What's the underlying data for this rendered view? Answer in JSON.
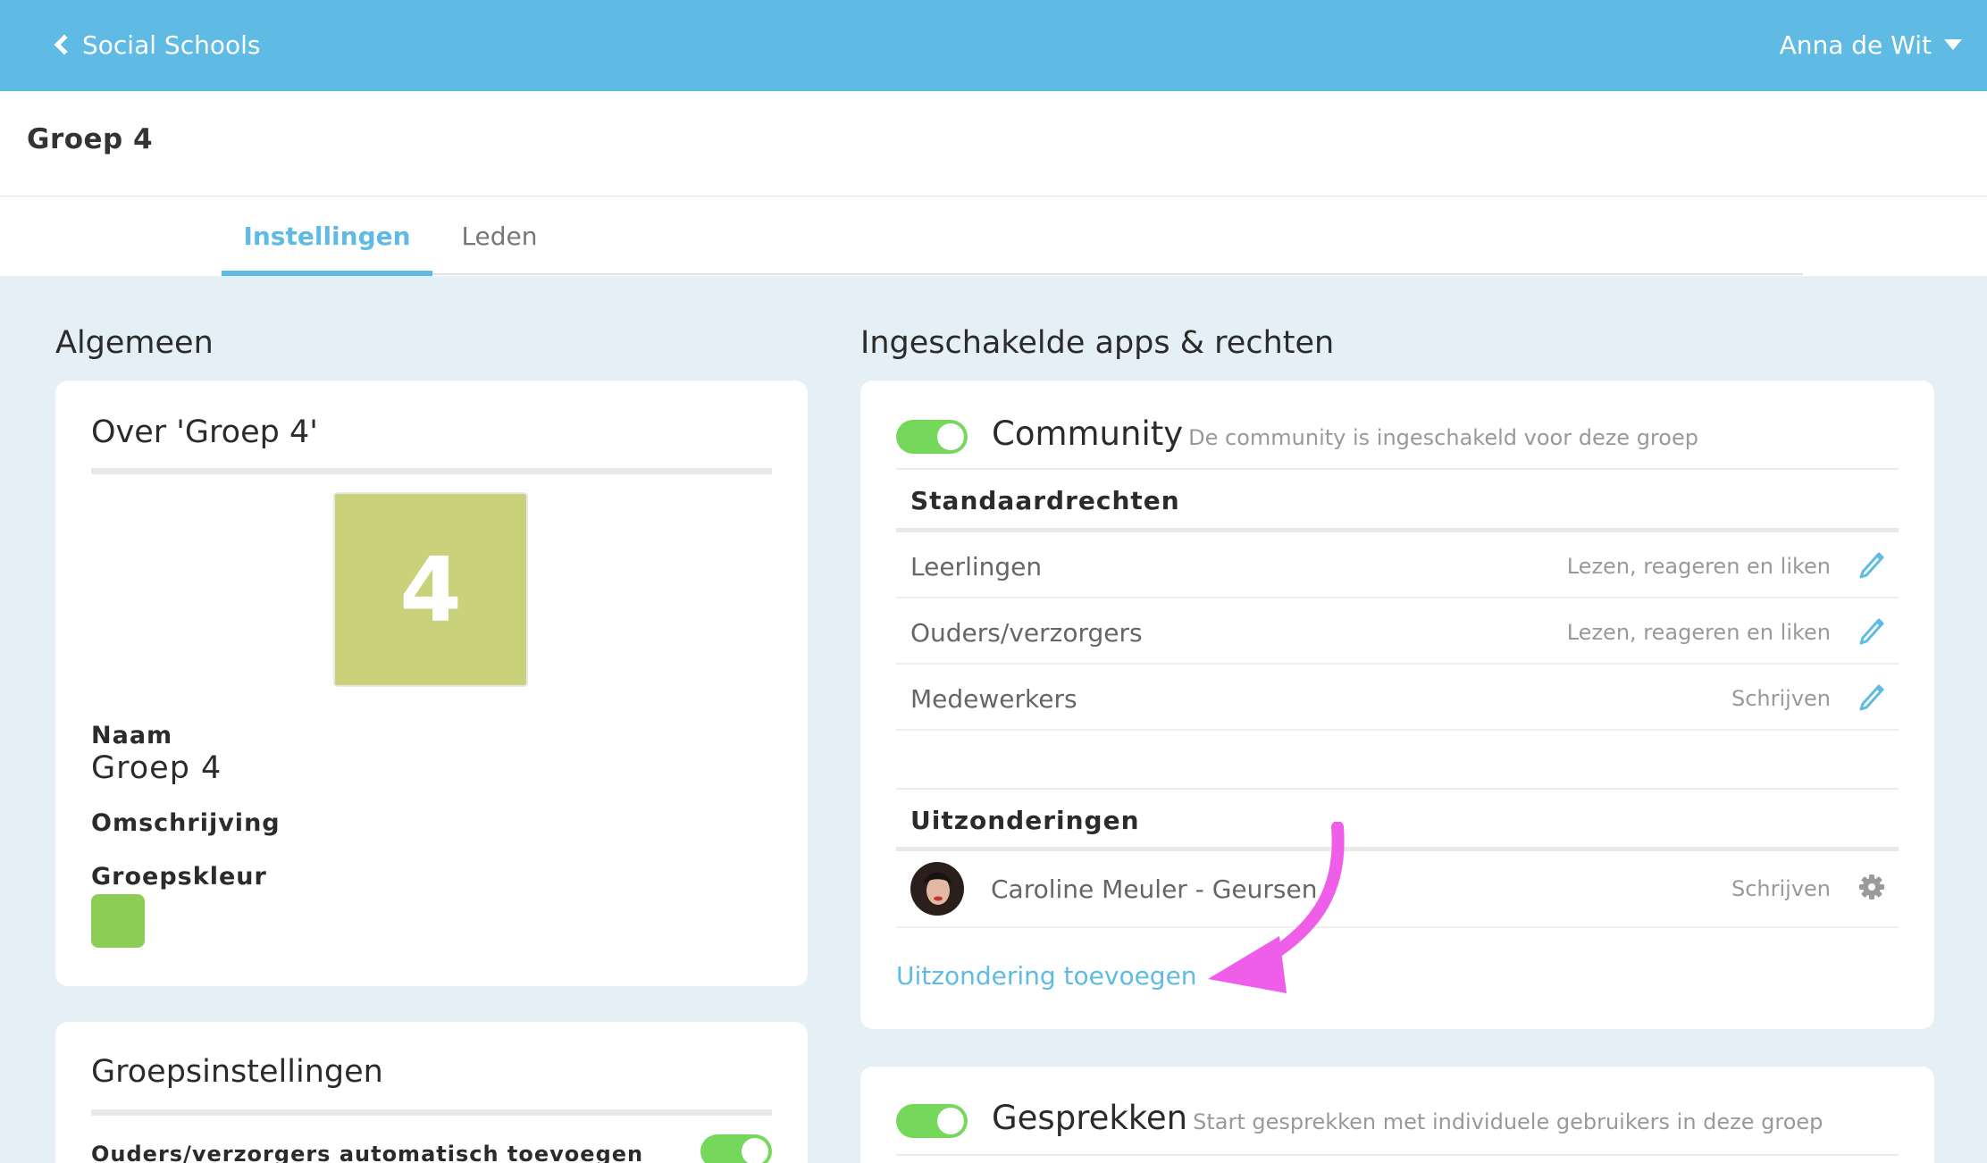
{
  "topbar": {
    "back_label": "Social Schools",
    "user_name": "Anna de Wit"
  },
  "page": {
    "title": "Groep 4"
  },
  "tabs": [
    {
      "label": "Instellingen",
      "active": true
    },
    {
      "label": "Leden",
      "active": false
    }
  ],
  "general": {
    "heading": "Algemeen",
    "about": {
      "title": "Over 'Groep 4'",
      "avatar_text": "4",
      "avatar_color": "#c9d17a",
      "name_label": "Naam",
      "name_value": "Groep 4",
      "description_label": "Omschrijving",
      "color_label": "Groepskleur",
      "group_color": "#8bcd55"
    },
    "settings": {
      "title": "Groepsinstellingen",
      "auto_add_label": "Ouders/verzorgers automatisch toevoegen",
      "auto_add_enabled": true
    }
  },
  "apps": {
    "heading": "Ingeschakelde apps & rechten",
    "community": {
      "enabled": true,
      "title": "Community",
      "description": "De community is ingeschakeld voor deze groep",
      "standard_rights_heading": "Standaardrechten",
      "rights": [
        {
          "role": "Leerlingen",
          "permission": "Lezen, reageren en liken",
          "icon": "pencil-icon"
        },
        {
          "role": "Ouders/verzorgers",
          "permission": "Lezen, reageren en liken",
          "icon": "pencil-icon"
        },
        {
          "role": "Medewerkers",
          "permission": "Schrijven",
          "icon": "pencil-icon"
        }
      ],
      "exceptions_heading": "Uitzonderingen",
      "exceptions": [
        {
          "name": "Caroline Meuler - Geursen",
          "permission": "Schrijven",
          "icon": "gear-icon"
        }
      ],
      "add_exception_label": "Uitzondering toevoegen"
    },
    "conversations": {
      "enabled": true,
      "title": "Gesprekken",
      "description": "Start gesprekken met individuele gebruikers in deze groep"
    }
  },
  "colors": {
    "accent": "#5fbbe3",
    "toggle_on": "#76d85b",
    "annotation": "#ee5ee8"
  }
}
